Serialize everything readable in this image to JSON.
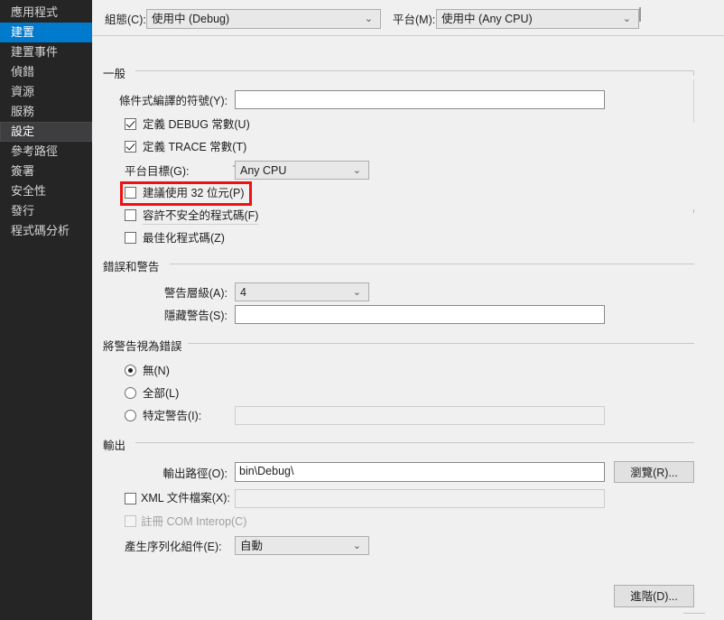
{
  "sidebar": {
    "items": [
      {
        "label": "應用程式",
        "state": "normal"
      },
      {
        "label": "建置",
        "state": "selected"
      },
      {
        "label": "建置事件",
        "state": "normal"
      },
      {
        "label": "偵錯",
        "state": "normal"
      },
      {
        "label": "資源",
        "state": "normal"
      },
      {
        "label": "服務",
        "state": "normal"
      },
      {
        "label": "設定",
        "state": "hovered"
      },
      {
        "label": "參考路徑",
        "state": "normal"
      },
      {
        "label": "簽署",
        "state": "normal"
      },
      {
        "label": "安全性",
        "state": "normal"
      },
      {
        "label": "發行",
        "state": "normal"
      },
      {
        "label": "程式碼分析",
        "state": "normal"
      }
    ]
  },
  "topbar": {
    "configuration_label": "組態(C):",
    "configuration_value": "使用中 (Debug)",
    "platform_label": "平台(M):",
    "platform_value": "使用中 (Any CPU)",
    "chevron": "⌄"
  },
  "general": {
    "group_title": "一般",
    "conditional_symbols_label": "條件式編譯的符號(Y):",
    "conditional_symbols_value": "",
    "define_debug_label": "定義 DEBUG 常數(U)",
    "define_debug_checked": true,
    "define_trace_label": "定義 TRACE 常數(T)",
    "define_trace_checked": true,
    "platform_target_label": "平台目標(G):",
    "platform_target_value": "Any CPU",
    "prefer32_label": "建議使用 32 位元(P)",
    "prefer32_checked": false,
    "allow_unsafe_label": "容許不安全的程式碼(F)",
    "allow_unsafe_checked": false,
    "optimize_label": "最佳化程式碼(Z)",
    "optimize_checked": false
  },
  "errors_warnings": {
    "group_title": "錯誤和警告",
    "warning_level_label": "警告層級(A):",
    "warning_level_value": "4",
    "suppress_warnings_label": "隱藏警告(S):",
    "suppress_warnings_value": ""
  },
  "treat_warnings": {
    "group_title": "將警告視為錯誤",
    "none_label": "無(N)",
    "none_selected": true,
    "all_label": "全部(L)",
    "all_selected": false,
    "specific_label": "特定警告(I):",
    "specific_selected": false,
    "specific_value": ""
  },
  "output": {
    "group_title": "輸出",
    "output_path_label": "輸出路徑(O):",
    "output_path_value": "bin\\Debug\\",
    "browse_button": "瀏覽(R)...",
    "xml_doc_label": "XML 文件檔案(X):",
    "xml_doc_checked": false,
    "xml_doc_value": "",
    "com_interop_label": "註冊 COM Interop(C)",
    "com_interop_checked": false,
    "com_interop_disabled": true,
    "serialization_label": "產生序列化組件(E):",
    "serialization_value": "自動",
    "advanced_button": "進階(D)..."
  },
  "annotation": {
    "highlight_color": "#ee1111",
    "highlight_target": "建議使用 32 位元(P)"
  }
}
